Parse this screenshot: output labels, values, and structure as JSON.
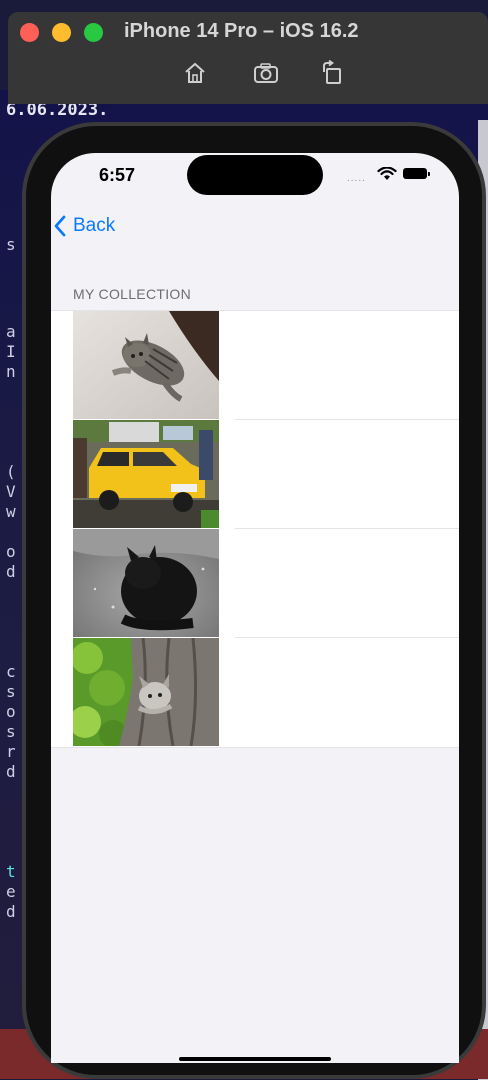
{
  "simulator": {
    "title": "iPhone 14 Pro – iOS 16.2",
    "toolbar": [
      "home-icon",
      "screenshot-icon",
      "rotate-icon"
    ]
  },
  "background_editor": {
    "date_text": "6.06.2023."
  },
  "status_bar": {
    "time": "6:57",
    "signal": "....."
  },
  "nav": {
    "back_label": "Back"
  },
  "collection": {
    "section_header": "MY COLLECTION",
    "items": [
      {
        "image": "kitten-lying-on-blanket"
      },
      {
        "image": "yellow-car-on-street"
      },
      {
        "image": "black-cat-grayscale"
      },
      {
        "image": "kitten-on-tree-trunk"
      }
    ]
  },
  "colors": {
    "accent": "#0a7aff",
    "grouped_background": "#f2f2f7",
    "section_header": "#6d6d72"
  }
}
